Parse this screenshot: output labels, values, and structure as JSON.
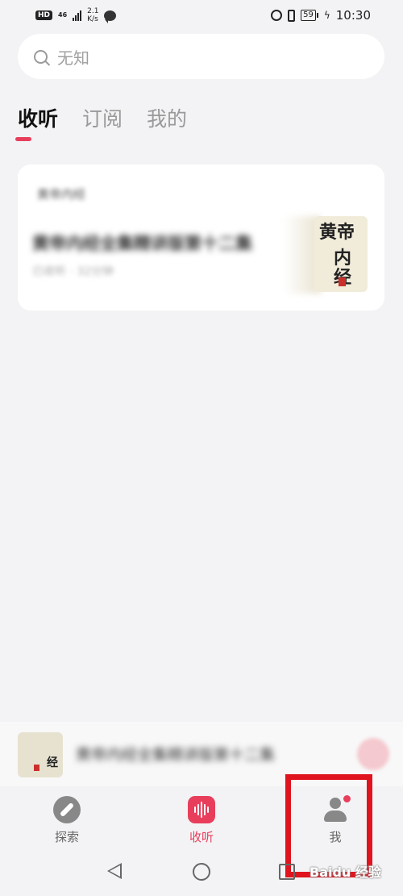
{
  "status_bar": {
    "hd": "HD",
    "network": "46",
    "speed_value": "2.1",
    "speed_unit": "K/s",
    "battery": "59",
    "time": "10:30"
  },
  "search": {
    "placeholder": "无知"
  },
  "tabs": [
    {
      "label": "收听",
      "active": true
    },
    {
      "label": "订阅",
      "active": false
    },
    {
      "label": "我的",
      "active": false
    }
  ],
  "card": {
    "section_title": "黄帝内经",
    "title": "黄帝内经全集精讲版第十二集",
    "subtitle": "已收听 · 32分钟",
    "cover_text_line1": "黄帝",
    "cover_text_line2": "内经"
  },
  "mini_player": {
    "title": "黄帝内经全集精讲版第十二集",
    "cover_text": "经"
  },
  "bottom_nav": [
    {
      "label": "探索",
      "icon": "compass-icon",
      "active": false
    },
    {
      "label": "收听",
      "icon": "sound-wave-icon",
      "active": true
    },
    {
      "label": "我",
      "icon": "person-icon",
      "active": false
    }
  ],
  "colors": {
    "accent": "#e83e5c",
    "highlight_box": "#e0141e",
    "background": "#f3f3f5"
  },
  "watermark": "Baidu 经验"
}
